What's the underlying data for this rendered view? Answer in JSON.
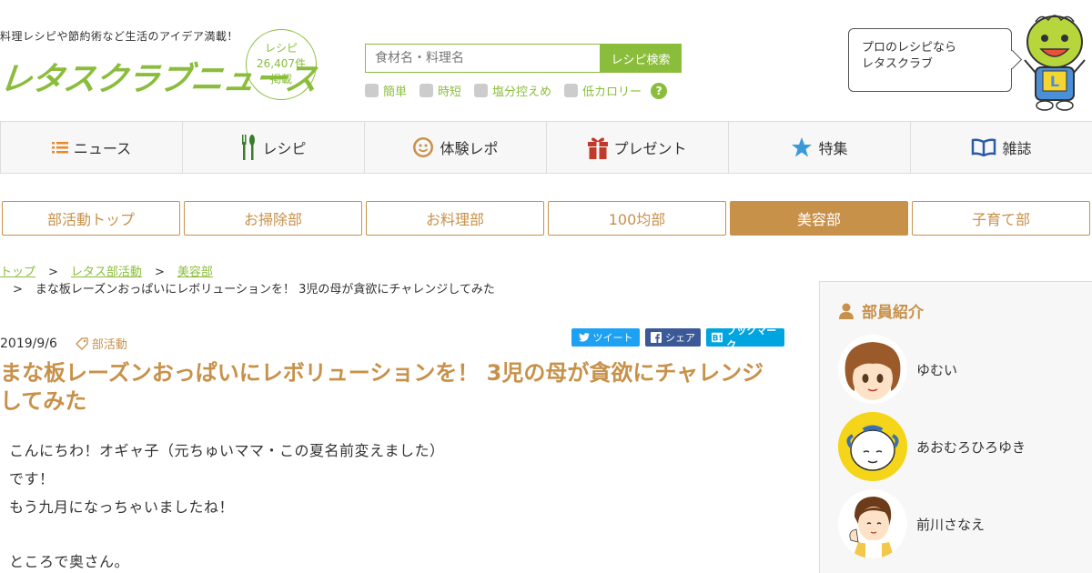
{
  "header": {
    "tagline": "料理レシピや節約術など生活のアイデア満載！",
    "logo": "レタスクラブニュース",
    "badge_line1": "レシピ",
    "badge_line2": "26,407件",
    "badge_line3": "掲載",
    "search_placeholder": "食材名・料理名",
    "search_button": "レシピ検索",
    "filters": [
      "簡単",
      "時短",
      "塩分控えめ",
      "低カロリー"
    ],
    "help": "?",
    "speech_line1": "プロのレシピなら",
    "speech_line2": "レタスクラブ"
  },
  "nav": [
    {
      "label": "ニュース",
      "icon": "list-icon"
    },
    {
      "label": "レシピ",
      "icon": "fork-spoon-icon"
    },
    {
      "label": "体験レポ",
      "icon": "smile-icon"
    },
    {
      "label": "プレゼント",
      "icon": "gift-icon"
    },
    {
      "label": "特集",
      "icon": "star-icon"
    },
    {
      "label": "雑誌",
      "icon": "book-icon"
    }
  ],
  "subtabs": [
    "部活動トップ",
    "お掃除部",
    "お料理部",
    "100均部",
    "美容部",
    "子育て部"
  ],
  "active_subtab": "美容部",
  "breadcrumb": {
    "items": [
      "トップ",
      "レタス部活動",
      "美容部"
    ],
    "sep": ">",
    "current": "まな板レーズンおっぱいにレボリューションを！ 3児の母が貪欲にチャレンジしてみた"
  },
  "article": {
    "date": "2019/9/6",
    "tag": "部活動",
    "share": {
      "tweet": "ツイート",
      "share": "シェア",
      "bookmark": "ブックマーク"
    },
    "title": "まな板レーズンおっぱいにレボリューションを！ 3児の母が貪欲にチャレンジしてみた",
    "body": [
      "こんにちわ！オギャ子（元ちゅいママ・この夏名前変えました）",
      "です！",
      "もう九月になっちゃいましたね！",
      "ところで奥さん。"
    ]
  },
  "sidebar": {
    "title": "部員紹介",
    "members": [
      "ゆむい",
      "あおむろひろゆき",
      "前川さなえ"
    ]
  },
  "colors": {
    "green": "#8bbd3c",
    "brown": "#c8914a"
  }
}
